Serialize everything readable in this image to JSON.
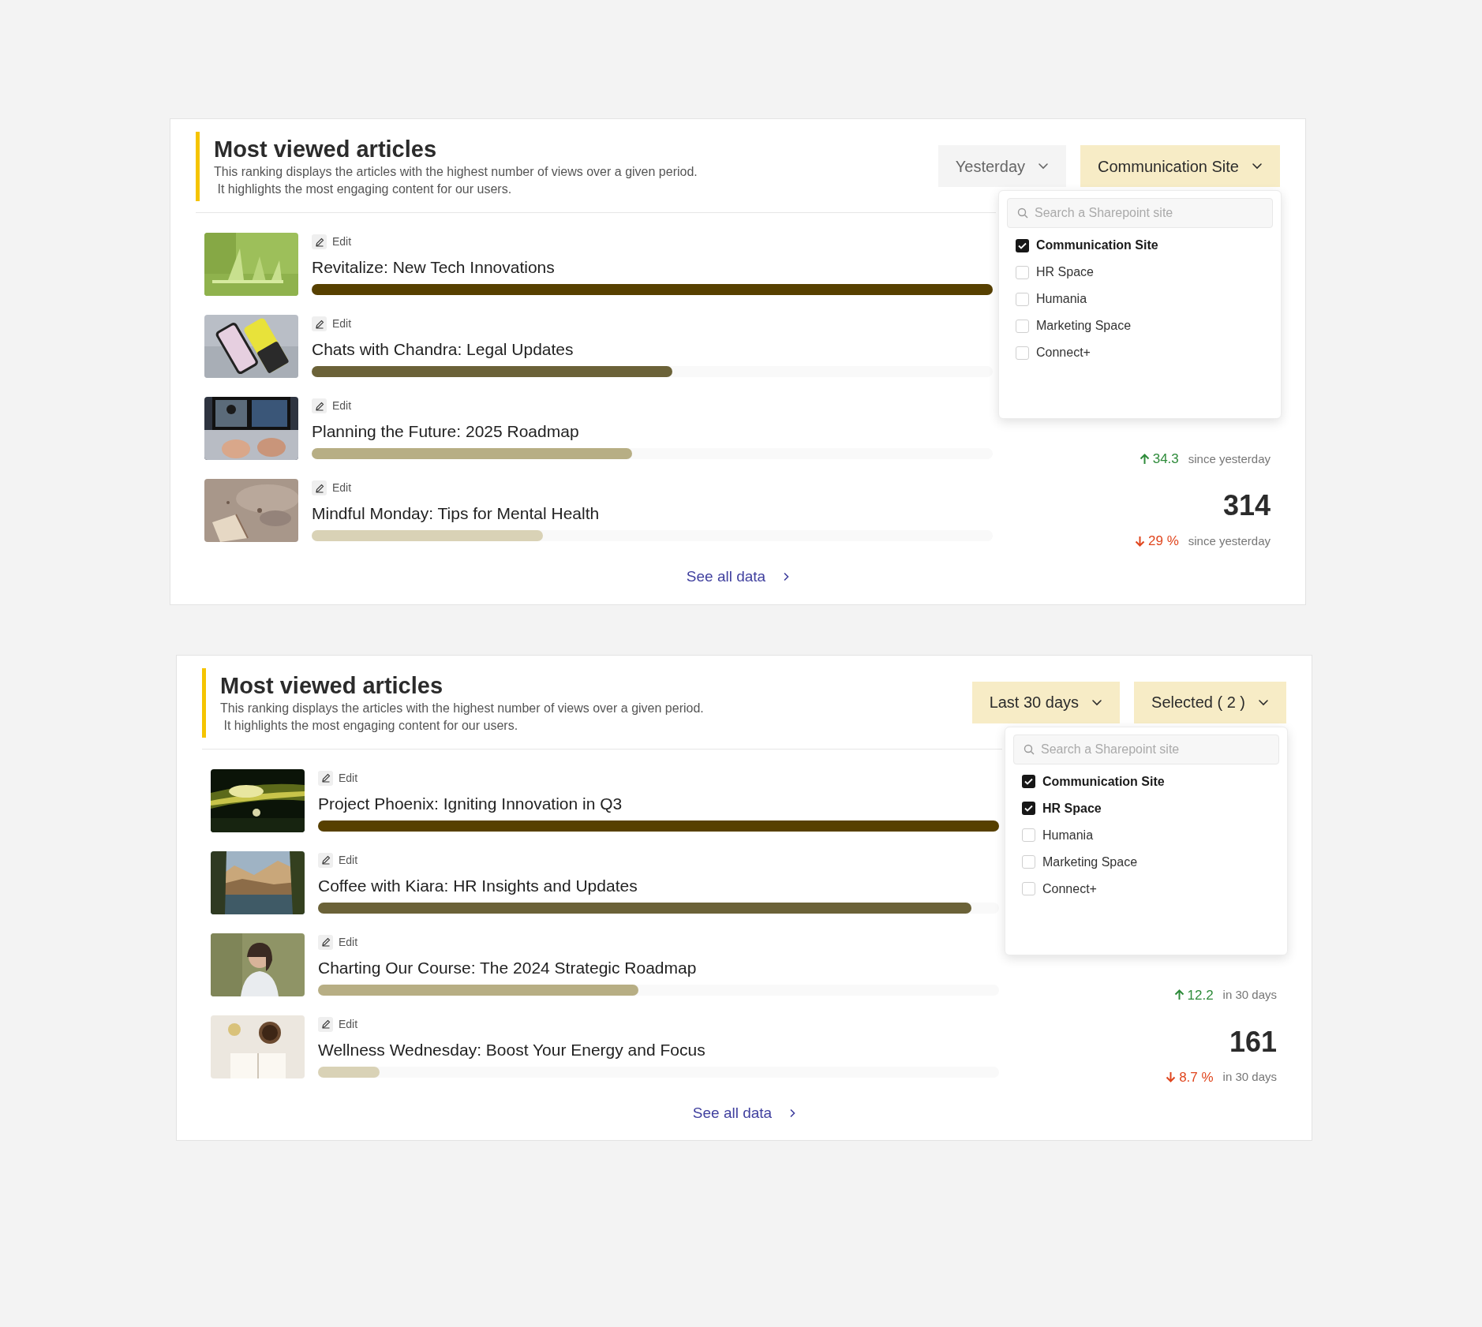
{
  "cards": [
    {
      "title": "Most viewed articles",
      "description": [
        "This ranking displays the articles with the highest number of views over a given period.",
        " It highlights the most engaging content for our users."
      ],
      "period_filter": {
        "label": "Yesterday",
        "highlighted": false
      },
      "site_filter": {
        "label": "Communication Site",
        "highlighted": true
      },
      "dropdown": {
        "placeholder": "Search a Sharepoint site",
        "options": [
          {
            "label": "Communication Site",
            "checked": true
          },
          {
            "label": "HR Space",
            "checked": false
          },
          {
            "label": "Humania",
            "checked": false
          },
          {
            "label": "Marketing Space",
            "checked": false
          },
          {
            "label": "Connect+",
            "checked": false
          }
        ]
      },
      "articles": [
        {
          "edit": "Edit",
          "title": "Revitalize: New Tech Innovations",
          "level": 1.0
        },
        {
          "edit": "Edit",
          "title": "Chats with Chandra: Legal Updates",
          "level": 0.53
        },
        {
          "edit": "Edit",
          "title": "Planning the Future: 2025 Roadmap",
          "level": 0.47,
          "stats": {
            "increase": true,
            "change": "34.3",
            "period": "since yesterday"
          }
        },
        {
          "edit": "Edit",
          "title": "Mindful Monday: Tips for Mental Health",
          "level": 0.34,
          "stats": {
            "views": "314",
            "increase": false,
            "change": "29 %",
            "period": "since yesterday"
          }
        }
      ],
      "link": "See all data"
    },
    {
      "title": "Most viewed articles",
      "description": [
        "This ranking displays the articles with the highest number of views over a given period.",
        " It highlights the most engaging content for our users."
      ],
      "period_filter": {
        "label": "Last 30 days",
        "highlighted": true
      },
      "site_filter": {
        "label": "Selected ( 2 )",
        "highlighted": true
      },
      "dropdown": {
        "placeholder": "Search a Sharepoint site",
        "options": [
          {
            "label": "Communication Site",
            "checked": true
          },
          {
            "label": "HR Space",
            "checked": true
          },
          {
            "label": "Humania",
            "checked": false
          },
          {
            "label": "Marketing Space",
            "checked": false
          },
          {
            "label": "Connect+",
            "checked": false
          }
        ]
      },
      "articles": [
        {
          "edit": "Edit",
          "title": "Project Phoenix: Igniting Innovation in Q3",
          "level": 1.0
        },
        {
          "edit": "Edit",
          "title": "Coffee with Kiara: HR Insights and Updates",
          "level": 0.96
        },
        {
          "edit": "Edit",
          "title": "Charting Our Course: The 2024 Strategic Roadmap",
          "level": 0.47,
          "stats": {
            "increase": true,
            "change": "12.2",
            "period": "in 30 days"
          }
        },
        {
          "edit": "Edit",
          "title": "Wellness Wednesday: Boost Your Energy and Focus",
          "level": 0.09,
          "stats": {
            "views": "161",
            "increase": false,
            "change": "8.7 %",
            "period": "in 30 days"
          }
        }
      ],
      "link": "See all data"
    }
  ]
}
